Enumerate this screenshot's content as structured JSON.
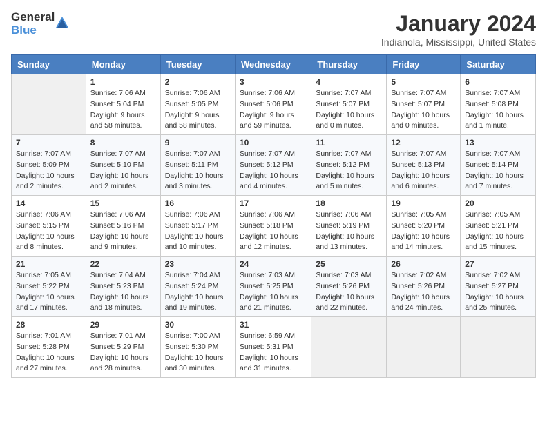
{
  "header": {
    "logo_general": "General",
    "logo_blue": "Blue",
    "title": "January 2024",
    "subtitle": "Indianola, Mississippi, United States"
  },
  "calendar": {
    "days_of_week": [
      "Sunday",
      "Monday",
      "Tuesday",
      "Wednesday",
      "Thursday",
      "Friday",
      "Saturday"
    ],
    "weeks": [
      [
        {
          "day": "",
          "info": ""
        },
        {
          "day": "1",
          "info": "Sunrise: 7:06 AM\nSunset: 5:04 PM\nDaylight: 9 hours\nand 58 minutes."
        },
        {
          "day": "2",
          "info": "Sunrise: 7:06 AM\nSunset: 5:05 PM\nDaylight: 9 hours\nand 58 minutes."
        },
        {
          "day": "3",
          "info": "Sunrise: 7:06 AM\nSunset: 5:06 PM\nDaylight: 9 hours\nand 59 minutes."
        },
        {
          "day": "4",
          "info": "Sunrise: 7:07 AM\nSunset: 5:07 PM\nDaylight: 10 hours\nand 0 minutes."
        },
        {
          "day": "5",
          "info": "Sunrise: 7:07 AM\nSunset: 5:07 PM\nDaylight: 10 hours\nand 0 minutes."
        },
        {
          "day": "6",
          "info": "Sunrise: 7:07 AM\nSunset: 5:08 PM\nDaylight: 10 hours\nand 1 minute."
        }
      ],
      [
        {
          "day": "7",
          "info": "Sunrise: 7:07 AM\nSunset: 5:09 PM\nDaylight: 10 hours\nand 2 minutes."
        },
        {
          "day": "8",
          "info": "Sunrise: 7:07 AM\nSunset: 5:10 PM\nDaylight: 10 hours\nand 2 minutes."
        },
        {
          "day": "9",
          "info": "Sunrise: 7:07 AM\nSunset: 5:11 PM\nDaylight: 10 hours\nand 3 minutes."
        },
        {
          "day": "10",
          "info": "Sunrise: 7:07 AM\nSunset: 5:12 PM\nDaylight: 10 hours\nand 4 minutes."
        },
        {
          "day": "11",
          "info": "Sunrise: 7:07 AM\nSunset: 5:12 PM\nDaylight: 10 hours\nand 5 minutes."
        },
        {
          "day": "12",
          "info": "Sunrise: 7:07 AM\nSunset: 5:13 PM\nDaylight: 10 hours\nand 6 minutes."
        },
        {
          "day": "13",
          "info": "Sunrise: 7:07 AM\nSunset: 5:14 PM\nDaylight: 10 hours\nand 7 minutes."
        }
      ],
      [
        {
          "day": "14",
          "info": "Sunrise: 7:06 AM\nSunset: 5:15 PM\nDaylight: 10 hours\nand 8 minutes."
        },
        {
          "day": "15",
          "info": "Sunrise: 7:06 AM\nSunset: 5:16 PM\nDaylight: 10 hours\nand 9 minutes."
        },
        {
          "day": "16",
          "info": "Sunrise: 7:06 AM\nSunset: 5:17 PM\nDaylight: 10 hours\nand 10 minutes."
        },
        {
          "day": "17",
          "info": "Sunrise: 7:06 AM\nSunset: 5:18 PM\nDaylight: 10 hours\nand 12 minutes."
        },
        {
          "day": "18",
          "info": "Sunrise: 7:06 AM\nSunset: 5:19 PM\nDaylight: 10 hours\nand 13 minutes."
        },
        {
          "day": "19",
          "info": "Sunrise: 7:05 AM\nSunset: 5:20 PM\nDaylight: 10 hours\nand 14 minutes."
        },
        {
          "day": "20",
          "info": "Sunrise: 7:05 AM\nSunset: 5:21 PM\nDaylight: 10 hours\nand 15 minutes."
        }
      ],
      [
        {
          "day": "21",
          "info": "Sunrise: 7:05 AM\nSunset: 5:22 PM\nDaylight: 10 hours\nand 17 minutes."
        },
        {
          "day": "22",
          "info": "Sunrise: 7:04 AM\nSunset: 5:23 PM\nDaylight: 10 hours\nand 18 minutes."
        },
        {
          "day": "23",
          "info": "Sunrise: 7:04 AM\nSunset: 5:24 PM\nDaylight: 10 hours\nand 19 minutes."
        },
        {
          "day": "24",
          "info": "Sunrise: 7:03 AM\nSunset: 5:25 PM\nDaylight: 10 hours\nand 21 minutes."
        },
        {
          "day": "25",
          "info": "Sunrise: 7:03 AM\nSunset: 5:26 PM\nDaylight: 10 hours\nand 22 minutes."
        },
        {
          "day": "26",
          "info": "Sunrise: 7:02 AM\nSunset: 5:26 PM\nDaylight: 10 hours\nand 24 minutes."
        },
        {
          "day": "27",
          "info": "Sunrise: 7:02 AM\nSunset: 5:27 PM\nDaylight: 10 hours\nand 25 minutes."
        }
      ],
      [
        {
          "day": "28",
          "info": "Sunrise: 7:01 AM\nSunset: 5:28 PM\nDaylight: 10 hours\nand 27 minutes."
        },
        {
          "day": "29",
          "info": "Sunrise: 7:01 AM\nSunset: 5:29 PM\nDaylight: 10 hours\nand 28 minutes."
        },
        {
          "day": "30",
          "info": "Sunrise: 7:00 AM\nSunset: 5:30 PM\nDaylight: 10 hours\nand 30 minutes."
        },
        {
          "day": "31",
          "info": "Sunrise: 6:59 AM\nSunset: 5:31 PM\nDaylight: 10 hours\nand 31 minutes."
        },
        {
          "day": "",
          "info": ""
        },
        {
          "day": "",
          "info": ""
        },
        {
          "day": "",
          "info": ""
        }
      ]
    ]
  }
}
